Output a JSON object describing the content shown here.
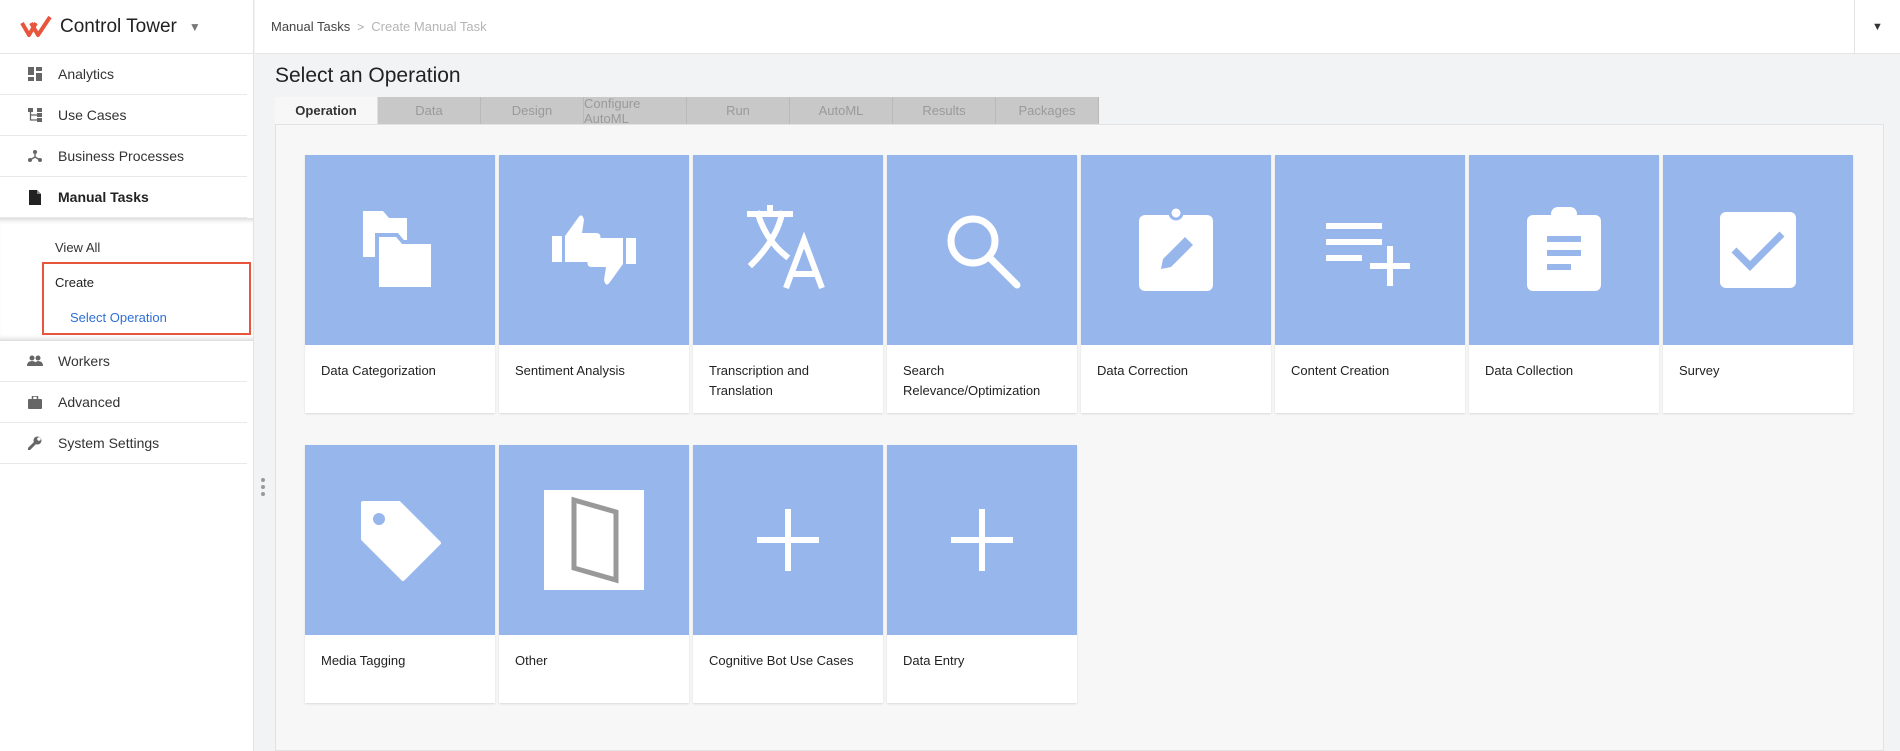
{
  "app": {
    "title": "Control Tower"
  },
  "sidebar": {
    "items": [
      {
        "label": "Analytics",
        "icon": "dashboard-icon"
      },
      {
        "label": "Use Cases",
        "icon": "hierarchy-icon"
      },
      {
        "label": "Business Processes",
        "icon": "process-icon"
      },
      {
        "label": "Manual Tasks",
        "icon": "document-icon"
      },
      {
        "label": "Workers",
        "icon": "people-icon"
      },
      {
        "label": "Advanced",
        "icon": "briefcase-icon"
      },
      {
        "label": "System Settings",
        "icon": "wrench-icon"
      }
    ],
    "submenu": {
      "view_all": "View All",
      "create": "Create",
      "select_operation": "Select Operation"
    }
  },
  "breadcrumb": {
    "items": [
      "Manual Tasks",
      "Create Manual Task"
    ],
    "separator": ">"
  },
  "page": {
    "title": "Select an Operation"
  },
  "tabs": [
    "Operation",
    "Data",
    "Design",
    "Configure AutoML",
    "Run",
    "AutoML",
    "Results",
    "Packages"
  ],
  "operations": [
    {
      "label": "Data Categorization",
      "icon": "folders-icon"
    },
    {
      "label": "Sentiment Analysis",
      "icon": "thumbs-icon"
    },
    {
      "label": "Transcription and Translation",
      "icon": "translate-icon"
    },
    {
      "label": "Search Relevance/Optimization",
      "icon": "search-icon"
    },
    {
      "label": "Data Correction",
      "icon": "clipboard-edit-icon"
    },
    {
      "label": "Content Creation",
      "icon": "playlist-add-icon"
    },
    {
      "label": "Data Collection",
      "icon": "clipboard-list-icon"
    },
    {
      "label": "Survey",
      "icon": "checkbox-icon"
    },
    {
      "label": "Media Tagging",
      "icon": "tag-icon"
    },
    {
      "label": "Other",
      "icon": "frame-icon"
    },
    {
      "label": "Cognitive Bot Use Cases",
      "icon": "plus-icon"
    },
    {
      "label": "Data Entry",
      "icon": "plus-icon"
    }
  ],
  "colors": {
    "accent": "#97b6ec",
    "highlight_border": "#e8553d",
    "link": "#2f6fd6",
    "brand": "#e8553d"
  }
}
